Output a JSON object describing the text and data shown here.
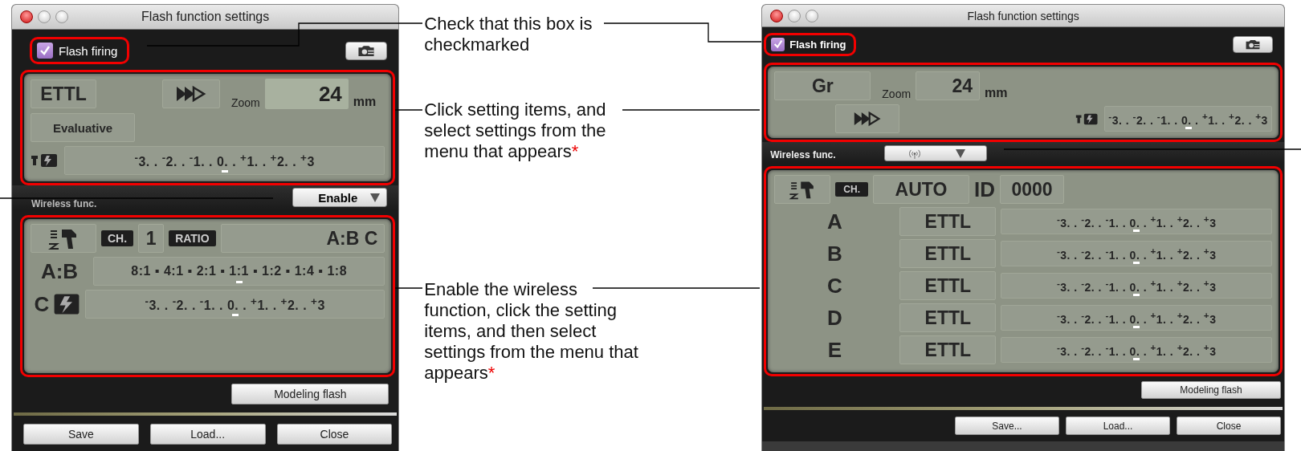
{
  "left_window": {
    "title": "Flash function settings",
    "flash_firing": {
      "label": "Flash firing",
      "checked": true
    },
    "flash_panel": {
      "mode": "ETTL",
      "zoom_label": "Zoom",
      "zoom_value": "24",
      "zoom_unit": "mm",
      "metering": "Evaluative",
      "comp_scale": {
        "text": "$^{-}$3. . $^{-}$2. . $^{-}$1. . 0. . $^{+}$1. . $^{+}$2. . $^{+}$3",
        "level": 0.5
      }
    },
    "wireless": {
      "label": "Wireless func.",
      "value": "Enable"
    },
    "wireless_panel": {
      "ch_label": "CH.",
      "channel": "1",
      "ratio_label": "RATIO",
      "ratio_value": "A:B C",
      "ab_label": "A:B",
      "ratio_scale": {
        "text": "8:1 ▪ 4:1 ▪ 2:1 ▪ 1:1 ▪ 1:2 ▪ 1:4 ▪ 1:8",
        "level": 0.5
      },
      "c_label": "C",
      "c_scale": {
        "text": "$^{-}$3. . $^{-}$2. . $^{-}$1. . 0. . $^{+}$1. . $^{+}$2. . $^{+}$3",
        "level": 0.5
      }
    },
    "modeling_button": "Modeling flash",
    "buttons": [
      "Save",
      "Load...",
      "Close"
    ]
  },
  "captions": [
    {
      "text": "Check that this box is checkmarked"
    },
    {
      "text": "Click setting items, and select settings from the menu that appears",
      "note": "*"
    },
    {
      "text": "Enable the wireless function, click the setting items, and then select settings from the menu that appears",
      "note": "*"
    }
  ],
  "right_window": {
    "title": "Flash function settings",
    "flash_firing": {
      "label": "Flash firing",
      "checked": true
    },
    "flash_panel": {
      "mode": "Gr",
      "zoom_label": "Zoom",
      "zoom_value": "24",
      "zoom_unit": "mm",
      "comp_scale": {
        "text": "$^{-}$3. . $^{-}$2. . $^{-}$1. . 0. . $^{+}$1. . $^{+}$2. . $^{+}$3",
        "level": 0.5
      }
    },
    "wireless": {
      "label": "Wireless func."
    },
    "wireless_panel": {
      "ch_label": "CH.",
      "channel": "AUTO",
      "id_label": "ID",
      "id_value": "0000",
      "groups": [
        {
          "name": "A",
          "mode": "ETTL",
          "scale": "$^{-}$3. . $^{-}$2. . $^{-}$1. . 0. . $^{+}$1. . $^{+}$2. . $^{+}$3",
          "level": 0.5
        },
        {
          "name": "B",
          "mode": "ETTL",
          "scale": "$^{-}$3. . $^{-}$2. . $^{-}$1. . 0. . $^{+}$1. . $^{+}$2. . $^{+}$3",
          "level": 0.5
        },
        {
          "name": "C",
          "mode": "ETTL",
          "scale": "$^{-}$3. . $^{-}$2. . $^{-}$1. . 0. . $^{+}$1. . $^{+}$2. . $^{+}$3",
          "level": 0.5
        },
        {
          "name": "D",
          "mode": "ETTL",
          "scale": "$^{-}$3. . $^{-}$2. . $^{-}$1. . 0. . $^{+}$1. . $^{+}$2. . $^{+}$3",
          "level": 0.5
        },
        {
          "name": "E",
          "mode": "ETTL",
          "scale": "$^{-}$3. . $^{-}$2. . $^{-}$1. . 0. . $^{+}$1. . $^{+}$2. . $^{+}$3",
          "level": 0.5
        }
      ]
    },
    "modeling_button": "Modeling flash",
    "buttons": [
      "Save...",
      "Load...",
      "Close"
    ]
  }
}
